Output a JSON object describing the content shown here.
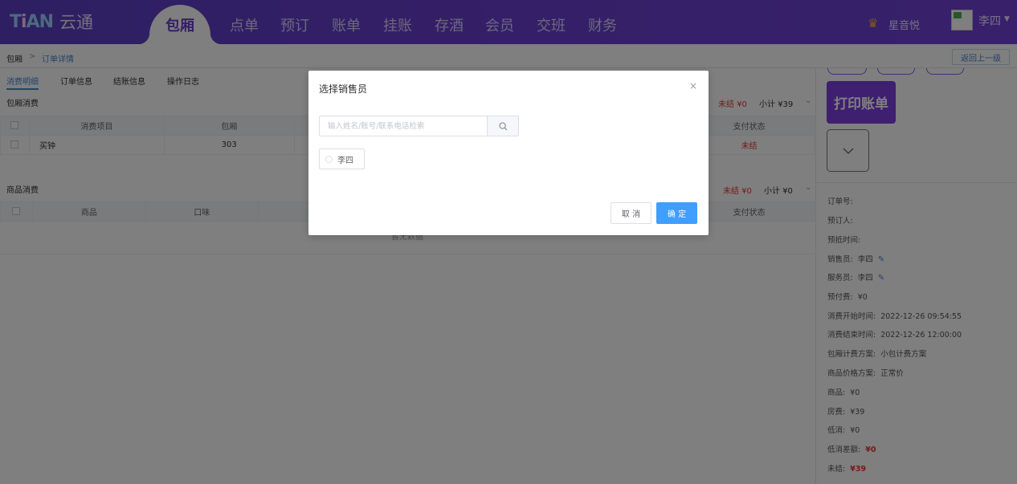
{
  "app": {
    "logo_text": "云通",
    "active_nav": "包厢",
    "nav": [
      "点单",
      "预订",
      "账单",
      "挂账",
      "存酒",
      "会员",
      "交班",
      "财务"
    ],
    "shop_name": "星音悦",
    "user_name": "李四"
  },
  "breadcrumb": {
    "root": "包厢",
    "separator": ">",
    "current": "订单详情",
    "back_label": "返回上一级"
  },
  "tabs": [
    "消费明细",
    "订单信息",
    "结账信息",
    "操作日志"
  ],
  "room_section": {
    "title": "包厢消费",
    "unsettled_label": "未结",
    "unsettled_value": "¥0",
    "subtotal_label": "小计",
    "subtotal_value": "¥39",
    "headers": [
      "消费项目",
      "包厢",
      "支付状态"
    ],
    "rows": [
      {
        "item": "买钟",
        "room": "303",
        "status": "未结"
      }
    ]
  },
  "goods_section": {
    "title": "商品消费",
    "unsettled_label": "未结",
    "unsettled_value": "¥0",
    "subtotal_label": "小计",
    "subtotal_value": "¥0",
    "headers": [
      "商品",
      "口味",
      "支付状态"
    ],
    "empty_text": "暂无数据"
  },
  "right_panel": {
    "print_label": "打印账单",
    "info": [
      {
        "label": "订单号:",
        "value": ""
      },
      {
        "label": "预订人:",
        "value": ""
      },
      {
        "label": "预抵时间:",
        "value": ""
      },
      {
        "label": "销售员:",
        "value": "李四"
      },
      {
        "label": "服务员:",
        "value": "李四"
      },
      {
        "label": "预付费:",
        "value": "¥0"
      },
      {
        "label": "消费开始时间:",
        "value": "2022-12-26 09:54:55"
      },
      {
        "label": "消费结束时间:",
        "value": "2022-12-26 12:00:00"
      },
      {
        "label": "包厢计费方案:",
        "value": "小包计费方案"
      },
      {
        "label": "商品价格方案:",
        "value": "正常价"
      },
      {
        "label": "商品:",
        "value": "¥0"
      },
      {
        "label": "房费:",
        "value": "¥39"
      },
      {
        "label": "低消:",
        "value": "¥0"
      },
      {
        "label": "低消差额:",
        "value": "¥0"
      },
      {
        "label": "未结:",
        "value": "¥39"
      }
    ]
  },
  "dialog": {
    "title": "选择销售员",
    "close": "×",
    "search_placeholder": "输入姓名/账号/联系电话检索",
    "search_value": "",
    "options": [
      "李四"
    ],
    "cancel_label": "取 消",
    "ok_label": "确 定"
  },
  "colors": {
    "nav_gradient_start": "#5b3fc4",
    "nav_gradient_end": "#7141d6",
    "accent_purple": "#7c3fe0",
    "link_blue": "#4a86d1",
    "primary_button": "#409eff",
    "unsettled_red": "#e53935"
  },
  "icons": {
    "crown": "crown-icon",
    "search": "search-icon",
    "close": "close-icon",
    "chevron_down": "chevron-down-icon",
    "edit": "pencil-icon"
  }
}
